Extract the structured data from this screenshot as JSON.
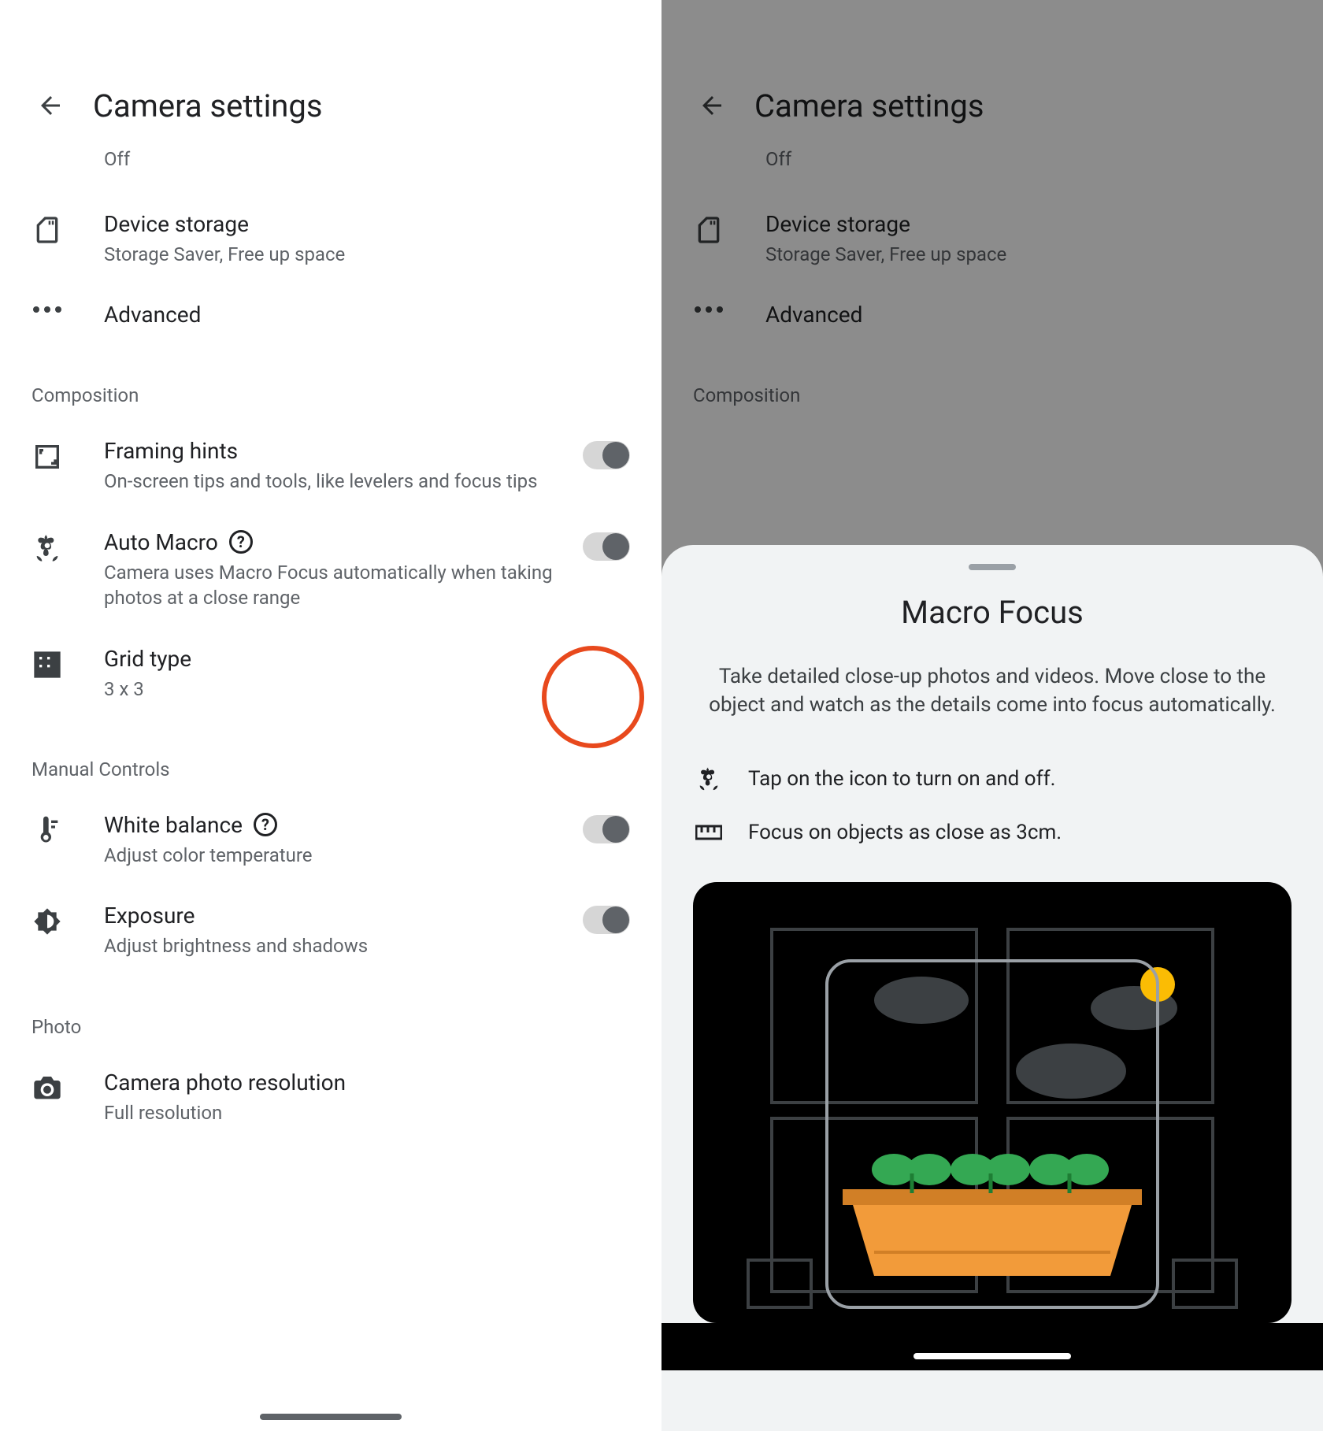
{
  "header": {
    "title": "Camera settings"
  },
  "off_label": "Off",
  "items": {
    "storage": {
      "title": "Device storage",
      "sub": "Storage Saver, Free up space"
    },
    "advanced": {
      "title": "Advanced"
    },
    "framing": {
      "title": "Framing hints",
      "sub": "On-screen tips and tools, like levelers and focus tips"
    },
    "automacro": {
      "title": "Auto Macro",
      "sub": "Camera uses Macro Focus automatically when taking photos at a close range"
    },
    "grid": {
      "title": "Grid type",
      "sub": "3 x 3"
    },
    "wb": {
      "title": "White balance",
      "sub": "Adjust color temperature"
    },
    "exposure": {
      "title": "Exposure",
      "sub": "Adjust brightness and shadows"
    },
    "resolution": {
      "title": "Camera photo resolution",
      "sub": "Full resolution"
    }
  },
  "sections": {
    "composition": "Composition",
    "manual": "Manual Controls",
    "photo": "Photo"
  },
  "sheet": {
    "title": "Macro Focus",
    "desc": "Take detailed close-up photos and videos. Move close to the object and watch as the details come into focus automatically.",
    "tip1": "Tap on the icon to turn on and off.",
    "tip2": "Focus on objects as close as 3cm."
  }
}
